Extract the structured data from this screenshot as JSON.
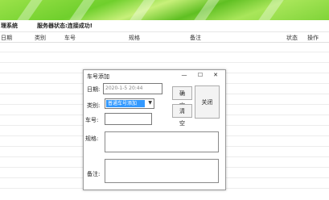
{
  "header": {
    "app_title": "理系统",
    "status_text": "服务器状态:连接成功!"
  },
  "grid": {
    "columns": [
      "日期",
      "类别",
      "车号",
      "规格",
      "备注",
      "状态",
      "操作"
    ]
  },
  "dialog": {
    "title": "车号添加",
    "minimize": "—",
    "maximize": "☐",
    "close": "✕",
    "date_label": "日期:",
    "date_value": "2020-1-5 20:44",
    "type_label": "类别:",
    "type_value": "普通车号添加",
    "plate_label": "车号:",
    "plate_value": "",
    "spec_label": "规格:",
    "spec_value": "",
    "remark_label": "备注:",
    "remark_value": "",
    "confirm_button": "确定",
    "clear_button": "清空",
    "close_button": "关闭"
  }
}
